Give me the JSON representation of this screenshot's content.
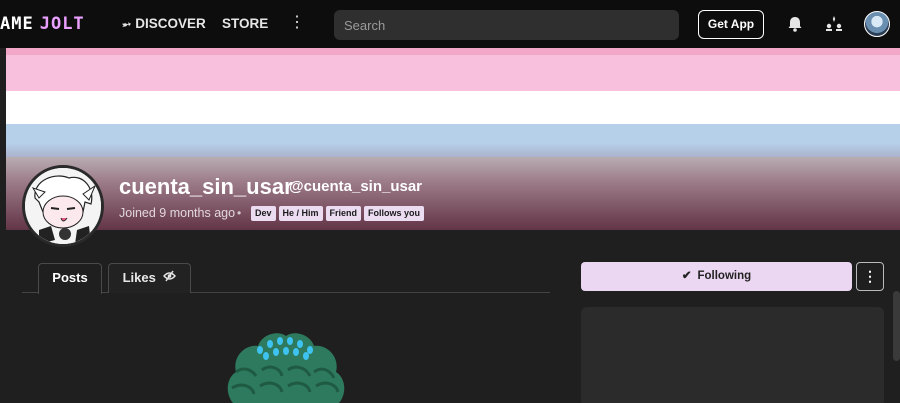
{
  "topbar": {
    "logo_left": "AME",
    "logo_right": "JOLT",
    "nav_discover": "DISCOVER",
    "nav_store": "STORE",
    "more_glyph": "⋮",
    "search_placeholder": "Search",
    "get_app": "Get App",
    "icons": [
      "bell-icon",
      "quests-icon",
      "user-avatar"
    ]
  },
  "banner": {
    "colors": [
      "#f2a6c8",
      "#f8c0dc",
      "#ffffff",
      "#b7d0ea",
      "#c8c8c8"
    ]
  },
  "profile": {
    "display_name": "cuenta_sin_usar",
    "handle": "@cuenta_sin_usar",
    "joined": "Joined 9 months ago",
    "separator": "•",
    "tags": [
      "Dev",
      "He / Him",
      "Friend",
      "Follows you"
    ]
  },
  "tabs": [
    {
      "label": "Posts",
      "active": true
    },
    {
      "label": "Likes",
      "active": false
    }
  ],
  "actions": {
    "following_label": "Following",
    "more_glyph": "⋮"
  },
  "theme": {
    "accent": "#ecd7f3",
    "topbar_bg": "#0d0d0d",
    "page_bg": "#1f1f1f"
  }
}
